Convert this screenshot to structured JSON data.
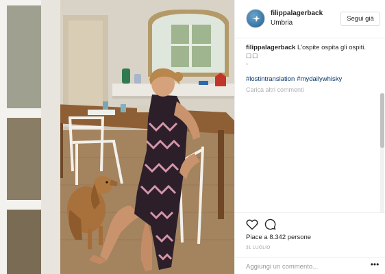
{
  "post": {
    "photo_alt": "",
    "author": {
      "username": "filippalagerback",
      "location": "Umbria",
      "follow_label": "Segui già"
    },
    "caption": {
      "username": "filippalagerback",
      "text": "L'ospite ospita gli ospiti.",
      "emoji_line": "☐☐",
      "dash_line": "-",
      "hashtags": [
        "#lostintranslation",
        "#mydailywhisky"
      ]
    },
    "load_more_label": "Carica altri commenti",
    "likes_text": "Piace a 8.342 persone",
    "date_text": "31 LUGLIO",
    "comment_input": {
      "placeholder": "Aggiungi un commento...",
      "value": ""
    },
    "more_label": "•••"
  },
  "colors": {
    "link": "#003569",
    "border": "#efefef",
    "text": "#262626",
    "muted": "#999999"
  },
  "icons": [
    "bird-avatar-icon",
    "heart-icon",
    "comment-icon",
    "more-options-icon",
    "scroll-down-arrow-icon"
  ]
}
